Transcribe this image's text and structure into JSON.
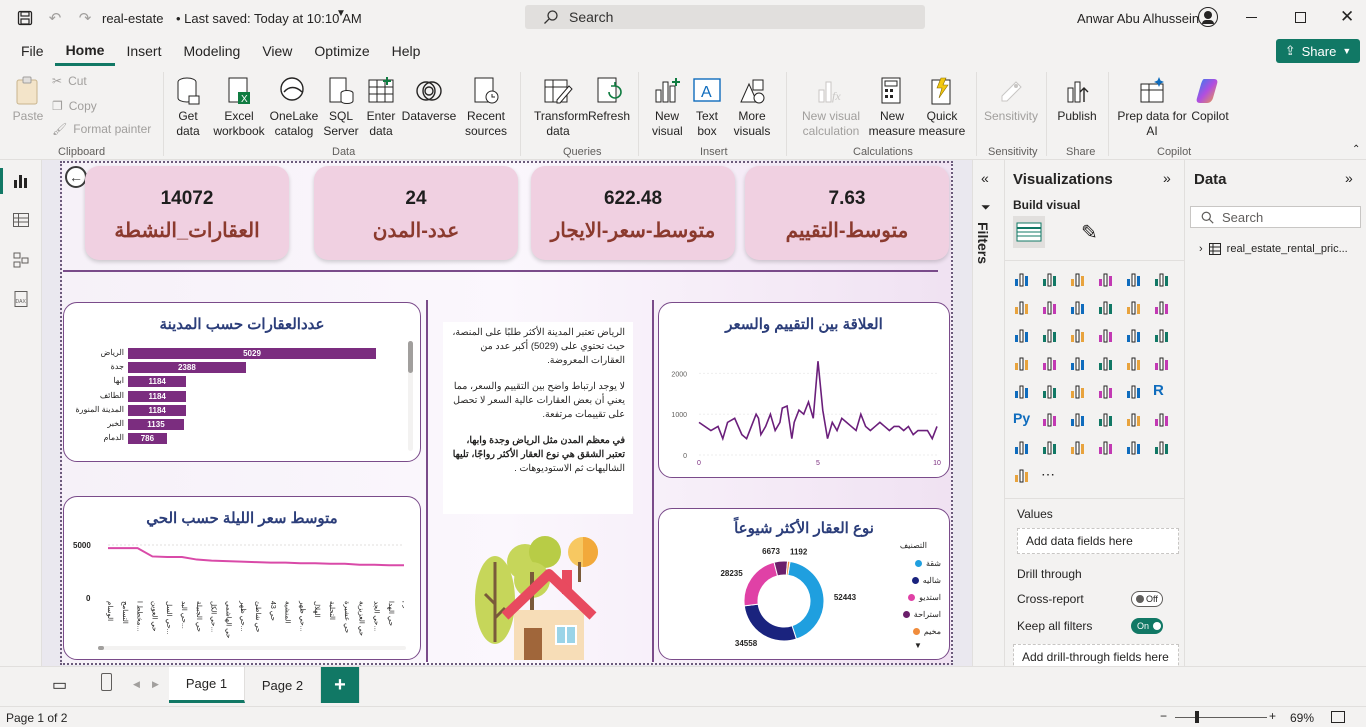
{
  "titlebar": {
    "filename": "real-estate",
    "saved": "• Last saved: Today at 10:10 AM",
    "search": "Search",
    "user": "Anwar Abu Alhussein"
  },
  "menu": {
    "file": "File",
    "home": "Home",
    "insert": "Insert",
    "modeling": "Modeling",
    "view": "View",
    "optimize": "Optimize",
    "help": "Help",
    "share": "Share"
  },
  "ribbon": {
    "paste": "Paste",
    "cut": "Cut",
    "copy": "Copy",
    "format_painter": "Format painter",
    "clipboard": "Clipboard",
    "get_data": "Get data",
    "excel": "Excel workbook",
    "onelake": "OneLake catalog",
    "sql": "SQL Server",
    "enter_data": "Enter data",
    "dataverse": "Dataverse",
    "recent": "Recent sources",
    "data": "Data",
    "transform": "Transform data",
    "refresh": "Refresh",
    "queries": "Queries",
    "new_visual": "New visual",
    "text_box": "Text box",
    "more_visuals": "More visuals",
    "insert": "Insert",
    "new_visual_calc": "New visual calculation",
    "new_measure": "New measure",
    "quick_measure": "Quick measure",
    "calculations": "Calculations",
    "sensitivity": "Sensitivity",
    "sensitivity_grp": "Sensitivity",
    "publish": "Publish",
    "share_grp": "Share",
    "copilot_prep": "Prep data for AI",
    "copilot": "Copilot",
    "copilot_grp": "Copilot"
  },
  "kpis": [
    {
      "value": "14072",
      "label": "العقارات_النشطة"
    },
    {
      "value": "24",
      "label": "عدد-المدن"
    },
    {
      "value": "622.48",
      "label": "متوسط-سعر-الايجار"
    },
    {
      "value": "7.63",
      "label": "متوسط-التقييم"
    }
  ],
  "city_chart": {
    "title": "عددالعقارات حسب المدينة"
  },
  "price_chart": {
    "title": "متوسط سعر الليلة حسب الحي",
    "ytick_top": "5000",
    "ytick_bottom": "0"
  },
  "scatter_chart": {
    "title": "العلاقة بين التقييم والسعر",
    "yticks": [
      "2000",
      "1000",
      "0"
    ],
    "xticks": [
      "0",
      "5",
      "10"
    ]
  },
  "donut_chart": {
    "title": "نوع العقار الأكثر شيوعاً",
    "legend_title": "التصنيف"
  },
  "textbox": {
    "p1": "الرياض تعتبر المدينة الأكثر طلبًا على المنصة، حيث تحتوي على (5029) أكبر عدد من",
    "p1b": "العقارات المعروضة.",
    "p2": "لا يوجد ارتباط واضح بين التقييم والسعر، مما يعني أن بعض العقارات عالية السعر لا تحصل",
    "p2b": "على تقييمات مرتفعة.",
    "p3": "في معظم المدن مثل الرياض وجدة وابها، تعتبر الشقق هي نوع العقار الأكثر رواجًا، تليها",
    "p3b": "الشاليهات ثم الاستوديوهات ."
  },
  "chart_data": [
    {
      "type": "bar",
      "title": "عددالعقارات حسب المدينة",
      "categories": [
        "الرياض",
        "جدة",
        "ابها",
        "الطائف",
        "المدينة المنورة",
        "الخبر",
        "الدمام"
      ],
      "values": [
        5029,
        2388,
        1184,
        1184,
        1184,
        1135,
        786
      ]
    },
    {
      "type": "line",
      "title": "متوسط سعر الليلة حسب الحي",
      "ylim": [
        0,
        5000
      ],
      "categories": [
        "الوسام",
        "التسامح",
        "مخطط ا...",
        "حي العوين",
        "حي السل...",
        "حي البد...",
        "حي الجبيلة",
        "حي الكل...",
        "حي الهاشمي",
        "حي ظهر...",
        "حي شاطئ",
        "حي 43",
        "المنشية",
        "حي ظهر...",
        "الهلال",
        "التحلية",
        "حي عشيرة",
        "حي العزيزية",
        "حي الجد...",
        "حي الهدا",
        "الحزم"
      ],
      "values": [
        4700,
        4700,
        4700,
        3900,
        3850,
        3850,
        3600,
        3500,
        3450,
        3400,
        3350,
        3300,
        3300,
        3250,
        3250,
        3200,
        3200,
        3100,
        3100,
        3050,
        3050
      ]
    },
    {
      "type": "line",
      "title": "العلاقة بين التقييم والسعر",
      "xlim": [
        0,
        10
      ],
      "ylim": [
        0,
        2500
      ],
      "x": [
        0,
        0.5,
        0.8,
        1,
        1.2,
        1.5,
        1.8,
        2,
        2.2,
        2.4,
        2.5,
        2.6,
        2.8,
        3,
        3.2,
        3.4,
        3.5,
        3.7,
        3.9,
        4,
        4.2,
        4.4,
        4.6,
        4.8,
        5,
        5.2,
        5.4,
        5.6,
        5.8,
        6,
        6.2,
        6.4,
        6.6,
        6.8,
        7,
        7.2,
        7.4,
        7.6,
        7.8,
        8,
        8.2,
        8.4,
        8.6,
        8.8,
        9,
        9.2,
        9.4,
        9.6,
        9.8,
        10
      ],
      "y": [
        800,
        600,
        700,
        400,
        800,
        900,
        500,
        400,
        700,
        1000,
        900,
        500,
        700,
        1000,
        600,
        800,
        1150,
        1200,
        400,
        800,
        1100,
        1000,
        1300,
        900,
        2300,
        1100,
        400,
        800,
        600,
        900,
        800,
        700,
        600,
        1000,
        700,
        600,
        700,
        800,
        700,
        600,
        700,
        700,
        600,
        700,
        500,
        600,
        600,
        600,
        400,
        700
      ]
    },
    {
      "type": "pie",
      "title": "نوع العقار الأكثر شيوعاً",
      "legend_title": "التصنيف",
      "categories": [
        "شقة",
        "شاليه",
        "استديو",
        "استراحة",
        "مخيم"
      ],
      "values": [
        52443,
        34558,
        28235,
        6673,
        1192
      ],
      "colors": [
        "#1f9fdf",
        "#1a237e",
        "#e041a6",
        "#6b1f6b",
        "#f08c3c"
      ]
    }
  ],
  "right": {
    "filters": "Filters",
    "viz_title": "Visualizations",
    "build_visual": "Build visual",
    "values": "Values",
    "add_data": "Add data fields here",
    "drill": "Drill through",
    "cross": "Cross-report",
    "cross_state": "Off",
    "keep": "Keep all filters",
    "keep_state": "On",
    "add_drill": "Add drill-through fields here",
    "data_title": "Data",
    "data_search": "Search",
    "table": "real_estate_rental_pric..."
  },
  "pages": {
    "p1": "Page 1",
    "p2": "Page 2",
    "add": "+"
  },
  "status": {
    "page": "Page 1 of 2",
    "zoom": "69%"
  }
}
